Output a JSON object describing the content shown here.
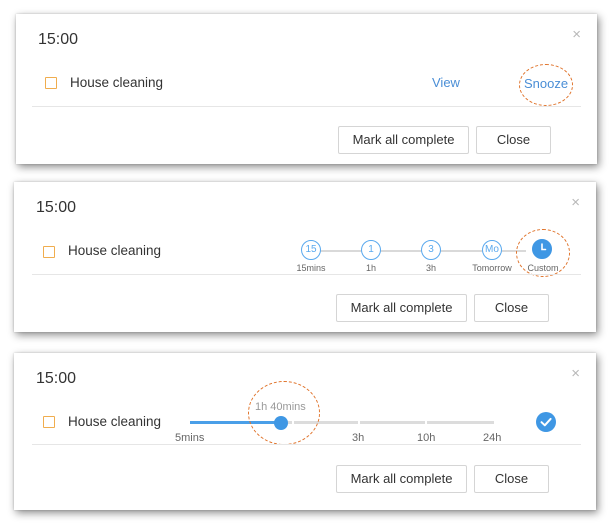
{
  "panels": [
    {
      "time": "15:00",
      "task": "House cleaning",
      "view_label": "View",
      "snooze_label": "Snooze",
      "mark_all_label": "Mark all complete",
      "close_label": "Close",
      "close_icon": "×"
    },
    {
      "time": "15:00",
      "task": "House cleaning",
      "snooze_options": [
        {
          "glyph": "15",
          "label": "15mins"
        },
        {
          "glyph": "1",
          "label": "1h"
        },
        {
          "glyph": "3",
          "label": "3h"
        },
        {
          "glyph": "Mo",
          "label": "Tomorrow"
        },
        {
          "icon": "clock-icon",
          "label": "Custom"
        }
      ],
      "mark_all_label": "Mark all complete",
      "close_label": "Close",
      "close_icon": "×"
    },
    {
      "time": "15:00",
      "task": "House cleaning",
      "slider": {
        "current": "1h 40mins",
        "min_label": "5mins",
        "marks": [
          "3h",
          "10h",
          "24h"
        ],
        "level_fraction": 0.3
      },
      "confirm_icon": "checkmark-icon",
      "mark_all_label": "Mark all complete",
      "close_label": "Close",
      "close_icon": "×"
    }
  ],
  "colors": {
    "accent": "#3f97e4",
    "link": "#4a8ed6",
    "checkbox": "#f0ad4e",
    "highlight": "#e0742c"
  }
}
